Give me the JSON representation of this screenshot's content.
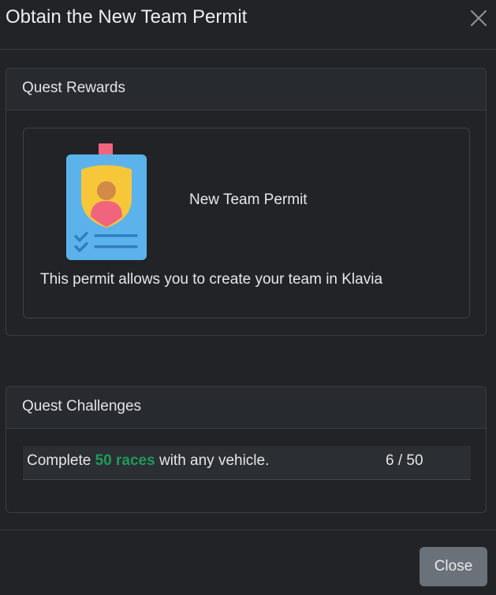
{
  "modal": {
    "title": "Obtain the New Team Permit",
    "close_icon": "close-icon"
  },
  "rewards": {
    "header": "Quest Rewards",
    "items": [
      {
        "name": "New Team Permit",
        "description": "This permit allows you to create your team in Klavia",
        "icon": "id-badge-icon"
      }
    ]
  },
  "challenges": {
    "header": "Quest Challenges",
    "items": [
      {
        "text_before": "Complete ",
        "highlight": "50 races",
        "text_after": " with any vehicle.",
        "progress": "6 / 50"
      }
    ]
  },
  "footer": {
    "close_label": "Close"
  },
  "colors": {
    "background": "#212327",
    "card_header": "#272a2f",
    "highlight": "#1f9a5a",
    "button": "#6b7178"
  }
}
